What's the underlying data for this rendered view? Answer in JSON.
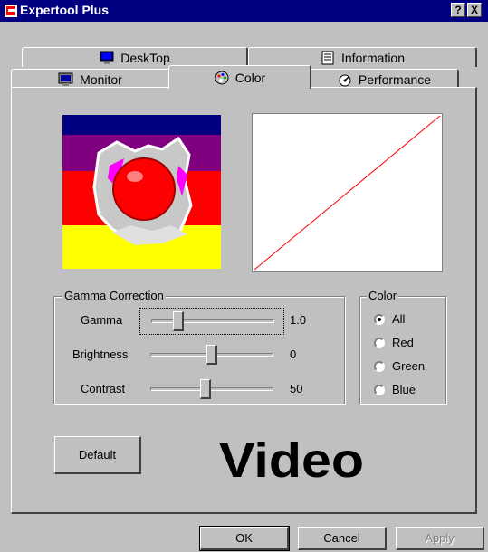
{
  "window": {
    "title": "Expertool Plus",
    "help_label": "?",
    "close_label": "X"
  },
  "tabs": {
    "row1": [
      {
        "label": "DeskTop",
        "icon": "desktop-icon"
      },
      {
        "label": "Information",
        "icon": "information-icon"
      }
    ],
    "row2": [
      {
        "label": "Monitor",
        "icon": "monitor-icon"
      },
      {
        "label": "Color",
        "icon": "color-palette-icon",
        "selected": true
      },
      {
        "label": "Performance",
        "icon": "performance-icon"
      }
    ]
  },
  "gamma_group": {
    "label": "Gamma Correction",
    "rows": [
      {
        "label": "Gamma",
        "value": "1.0",
        "level": 0.22
      },
      {
        "label": "Brightness",
        "value": "0",
        "level": 0.5
      },
      {
        "label": "Contrast",
        "value": "50",
        "level": 0.45
      }
    ]
  },
  "color_group": {
    "label": "Color",
    "options": [
      {
        "label": "All",
        "checked": true
      },
      {
        "label": "Red",
        "checked": false
      },
      {
        "label": "Green",
        "checked": false
      },
      {
        "label": "Blue",
        "checked": false
      }
    ]
  },
  "default_button": "Default",
  "logo_text": "Video",
  "footer": {
    "ok": "OK",
    "cancel": "Cancel",
    "apply": "Apply"
  },
  "colors": {
    "title_bar": "#000080",
    "gamma_curve": "#ff0000",
    "face": "#c0c0c0"
  }
}
